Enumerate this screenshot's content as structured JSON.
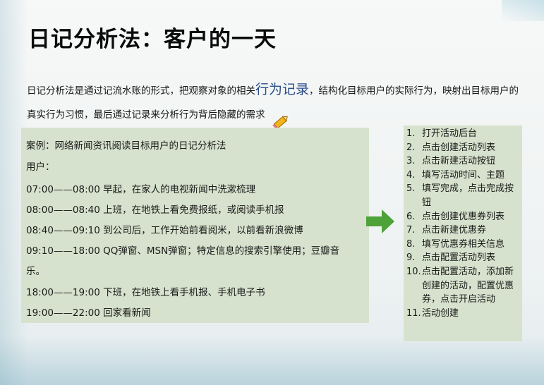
{
  "slide": {
    "title": "日记分析法：客户的一天",
    "intro_part1": "日记分析法是通过记流水账的形式，把观察对象的相关",
    "intro_highlight": "行为记录",
    "intro_part2": "，结构化目标用户的实际行为，映射出目标用户的真实行为习惯，最后通过记录来分析行为背后隐藏的需求"
  },
  "case": {
    "heading": "案例：网络新闻资讯阅读目标用户的日记分析法",
    "user_label": "用户：",
    "lines": [
      "07:00——08:00 早起，在家人的电视新闻中洗漱梳理",
      "08:00——08:40 上班，在地铁上看免费报纸，或阅读手机报",
      "08:40——09:10 到公司后，工作开始前看阅米，以前看新浪微博",
      "09:10——18:00 QQ弹窗、MSN弹窗；特定信息的搜索引擎使用；豆瓣音",
      "乐。",
      "18:00——19:00 下班，在地铁上看手机报、手机电子书",
      "19:00——22:00  回家看新闻"
    ]
  },
  "steps": [
    {
      "num": "1.",
      "text": "打开活动后台"
    },
    {
      "num": "2.",
      "text": "点击创建活动列表"
    },
    {
      "num": "3.",
      "text": "点击新建活动按钮"
    },
    {
      "num": "4.",
      "text": "填写活动时间、主题"
    },
    {
      "num": "5.",
      "text": "填写完成，点击完成按钮"
    },
    {
      "num": "6.",
      "text": "点击创建优惠券列表"
    },
    {
      "num": "7.",
      "text": "点击新建优惠券"
    },
    {
      "num": "8.",
      "text": "填写优惠券相关信息"
    },
    {
      "num": "9.",
      "text": "点击配置活动列表"
    },
    {
      "num": "10.",
      "text": "点击配置活动，添加新创建的活动，配置优惠券，点击开启活动"
    },
    {
      "num": "11.",
      "text": "活动创建"
    }
  ],
  "colors": {
    "box_fill": "#d6e2cd",
    "arrow": "#4ea23a",
    "highlight": "#2a4d8a"
  },
  "icons": {
    "arrow": "right-arrow-icon",
    "pointer": "pen-icon"
  }
}
